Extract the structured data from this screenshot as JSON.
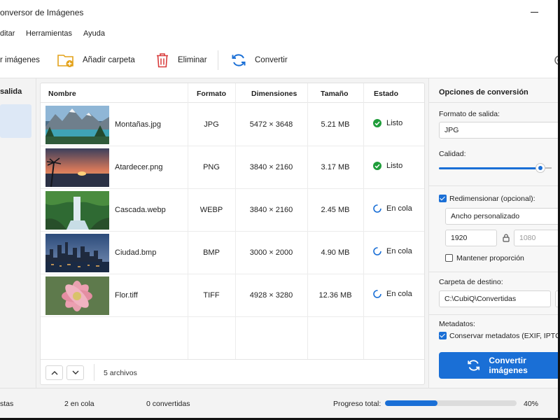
{
  "window": {
    "title": "onversor de Imágenes"
  },
  "menu": {
    "items": [
      "ditar",
      "Herramientas",
      "Ayuda"
    ]
  },
  "toolbar": {
    "add_images_label": "r imágenes",
    "add_folder_label": "Añadir carpeta",
    "delete_label": "Eliminar",
    "convert_label": "Convertir"
  },
  "left_panel": {
    "title": "salida"
  },
  "table": {
    "headers": [
      "Nombre",
      "Formato",
      "Dimensiones",
      "Tamaño",
      "Estado"
    ],
    "rows": [
      {
        "name": "Montañas.jpg",
        "format": "JPG",
        "dimensions": "5472 × 3648",
        "size": "5.21 MB",
        "status": "Listo",
        "status_kind": "done",
        "thumb": "mountains"
      },
      {
        "name": "Atardecer.png",
        "format": "PNG",
        "dimensions": "3840 × 2160",
        "size": "3.17 MB",
        "status": "Listo",
        "status_kind": "done",
        "thumb": "sunset"
      },
      {
        "name": "Cascada.webp",
        "format": "WEBP",
        "dimensions": "3840 × 2160",
        "size": "2.45 MB",
        "status": "En cola",
        "status_kind": "queued",
        "thumb": "waterfall"
      },
      {
        "name": "Ciudad.bmp",
        "format": "BMP",
        "dimensions": "3000 × 2000",
        "size": "4.90 MB",
        "status": "En cola",
        "status_kind": "queued",
        "thumb": "city"
      },
      {
        "name": "Flor.tiff",
        "format": "TIFF",
        "dimensions": "4928 × 3280",
        "size": "12.36 MB",
        "status": "En cola",
        "status_kind": "queued",
        "thumb": "flower"
      }
    ],
    "file_count": "5 archivos"
  },
  "options": {
    "title": "Opciones de conversión",
    "output_format_label": "Formato de salida:",
    "output_format_value": "JPG",
    "quality_label": "Calidad:",
    "quality_fraction": 0.92,
    "resize_label": "Redimensionar (opcional):",
    "resize_checked": true,
    "resize_mode": "Ancho personalizado",
    "width_value": "1920",
    "height_value": "1080",
    "keep_ratio_label": "Mantener proporción",
    "keep_ratio_checked": false,
    "dest_label": "Carpeta de destino:",
    "dest_value": "C:\\CubiQ\\Convertidas",
    "metadata_label": "Metadatos:",
    "metadata_keep_label": "Conservar metadatos (EXIF, IPTC, XM",
    "metadata_checked": true,
    "convert_button_label": "Convertir imágenes"
  },
  "status": {
    "ready_text": "stas",
    "queued_text": "2 en cola",
    "converted_text": "0 convertidas",
    "progress_label": "Progreso total:",
    "progress_percent": 40,
    "progress_text": "40%"
  },
  "colors": {
    "accent": "#1a6fd6",
    "success": "#1f9d3a"
  }
}
